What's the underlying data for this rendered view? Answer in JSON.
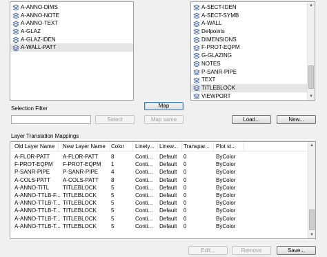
{
  "left_list": {
    "items": [
      {
        "label": "A-ANNO-DIMS",
        "selected": false
      },
      {
        "label": "A-ANNO-NOTE",
        "selected": false
      },
      {
        "label": "A-ANNO-TEXT",
        "selected": false
      },
      {
        "label": "A-GLAZ",
        "selected": false
      },
      {
        "label": "A-GLAZ-IDEN",
        "selected": false
      },
      {
        "label": "A-WALL-PATT",
        "selected": true
      }
    ]
  },
  "right_list": {
    "items": [
      {
        "label": "A-SECT-IDEN",
        "selected": false
      },
      {
        "label": "A-SECT-SYMB",
        "selected": false
      },
      {
        "label": "A-WALL",
        "selected": false
      },
      {
        "label": "Defpoints",
        "selected": false
      },
      {
        "label": "DIMENSIONS",
        "selected": false
      },
      {
        "label": "F-PROT-EQPM",
        "selected": false
      },
      {
        "label": "G-GLAZING",
        "selected": false
      },
      {
        "label": "NOTES",
        "selected": false
      },
      {
        "label": "P-SANR-PIPE",
        "selected": false
      },
      {
        "label": "TEXT",
        "selected": false
      },
      {
        "label": "TITLEBLOCK",
        "selected": true
      },
      {
        "label": "VIEWPORT",
        "selected": false
      }
    ]
  },
  "map_button": "Map",
  "map_same_button": "Map same",
  "selection_filter": {
    "label": "Selection Filter",
    "value": "",
    "select_button": "Select"
  },
  "load_button": "Load...",
  "new_button": "New...",
  "mappings": {
    "title": "Layer Translation Mappings",
    "columns": [
      "Old Layer Name",
      "New Layer Name",
      "Color",
      "Linety...",
      "Linew...",
      "Transpar...",
      "Plot st..."
    ],
    "rows": [
      [
        "A-FLOR-PATT",
        "A-FLOR-PATT",
        "8",
        "Conti...",
        "Default",
        "0",
        "ByColor"
      ],
      [
        "F-PROT-EQPM",
        "F-PROT-EQPM",
        "1",
        "Conti...",
        "Default",
        "0",
        "ByColor"
      ],
      [
        "P-SANR-PIPE",
        "P-SANR-PIPE",
        "4",
        "Conti...",
        "Default",
        "0",
        "ByColor"
      ],
      [
        "A-COLS-PATT",
        "A-COLS-PATT",
        "8",
        "Conti...",
        "Default",
        "0",
        "ByColor"
      ],
      [
        "A-ANNO-TITL",
        "TITLEBLOCK",
        "5",
        "Conti...",
        "Default",
        "0",
        "ByColor"
      ],
      [
        "A-ANNO-TTLB-F...",
        "TITLEBLOCK",
        "5",
        "Conti...",
        "Default",
        "0",
        "ByColor"
      ],
      [
        "A-ANNO-TTLB-T...",
        "TITLEBLOCK",
        "5",
        "Conti...",
        "Default",
        "0",
        "ByColor"
      ],
      [
        "A-ANNO-TTLB-T...",
        "TITLEBLOCK",
        "5",
        "Conti...",
        "Default",
        "0",
        "ByColor"
      ],
      [
        "A-ANNO-TTLB-T...",
        "TITLEBLOCK",
        "5",
        "Conti...",
        "Default",
        "0",
        "ByColor"
      ],
      [
        "A-ANNO-TTLB-T...",
        "TITLEBLOCK",
        "5",
        "Conti...",
        "Default",
        "0",
        "ByColor"
      ]
    ]
  },
  "edit_button": "Edit...",
  "remove_button": "Remove",
  "save_button": "Save..."
}
